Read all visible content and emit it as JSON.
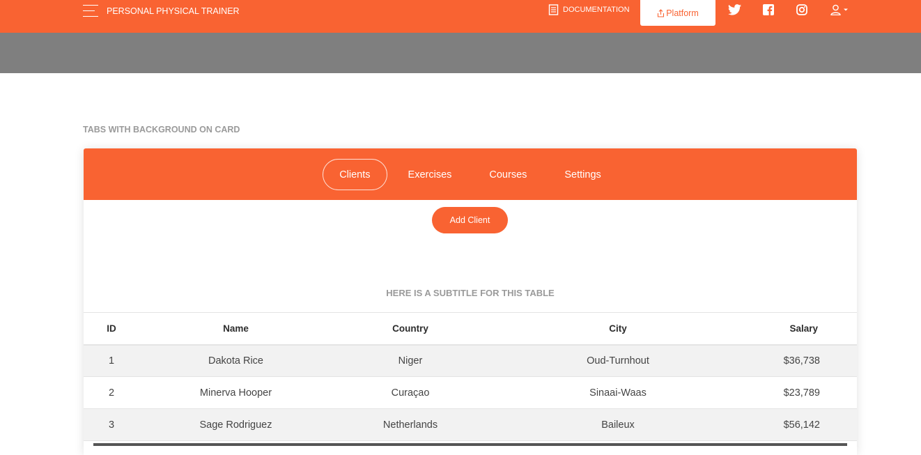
{
  "navbar": {
    "brand": "PERSONAL PHYSICAL TRAINER",
    "documentation_label": "DOCUMENTATION",
    "platform_label": "Platform",
    "social": [
      "twitter-icon",
      "facebook-icon",
      "instagram-icon"
    ],
    "user_icon": "user-icon",
    "accent_color": "#f96332"
  },
  "section": {
    "title": "TABS WITH BACKGROUND ON CARD"
  },
  "card": {
    "tabs": [
      {
        "label": "Clients",
        "active": true
      },
      {
        "label": "Exercises",
        "active": false
      },
      {
        "label": "Courses",
        "active": false
      },
      {
        "label": "Settings",
        "active": false
      }
    ],
    "add_button_label": "Add Client",
    "table_subtitle": "HERE IS A SUBTITLE FOR THIS TABLE",
    "table": {
      "headers": [
        "ID",
        "Name",
        "Country",
        "City",
        "Salary"
      ],
      "rows": [
        [
          "1",
          "Dakota Rice",
          "Niger",
          "Oud-Turnhout",
          "$36,738"
        ],
        [
          "2",
          "Minerva Hooper",
          "Curaçao",
          "Sinaai-Waas",
          "$23,789"
        ],
        [
          "3",
          "Sage Rodriguez",
          "Netherlands",
          "Baileux",
          "$56,142"
        ]
      ]
    }
  }
}
